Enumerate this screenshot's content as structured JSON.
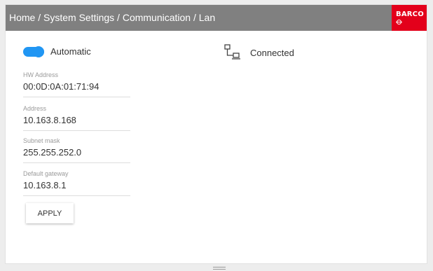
{
  "header": {
    "breadcrumb": "Home / System Settings / Communication / Lan",
    "logo_text": "BARCO",
    "logo_color": "#e3001b",
    "background_color": "#808080"
  },
  "lan": {
    "automatic": {
      "label": "Automatic",
      "enabled": true,
      "toggle_color": "#2196f3"
    },
    "fields": [
      {
        "label": "HW Address",
        "value": "00:0D:0A:01:71:94"
      },
      {
        "label": "Address",
        "value": "10.163.8.168"
      },
      {
        "label": "Subnet mask",
        "value": "255.255.252.0"
      },
      {
        "label": "Default gateway",
        "value": "10.163.8.1"
      }
    ],
    "apply_label": "APPLY"
  },
  "status": {
    "icon": "network-icon",
    "label": "Connected"
  }
}
